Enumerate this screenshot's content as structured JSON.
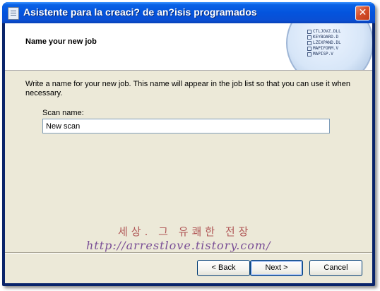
{
  "window": {
    "title": "Asistente para la creaci? de an?isis programados",
    "close_glyph": "✕"
  },
  "header": {
    "title": "Name your new job",
    "graphic_listing": [
      "CTLJOVZ.DLL",
      "KEYBOARD.D",
      "LZEXPAND.DL",
      "MAPIFORM.V",
      "MAPISP.V"
    ]
  },
  "body": {
    "description": "Write a name for your new job. This name will appear in the job list so that you can use it when necessary.",
    "scan_name_label": "Scan name:",
    "scan_name_value": "New scan"
  },
  "watermark": {
    "line1": "세상. 그 유쾌한 전장",
    "line2": "http://arrestlove.tistory.com/"
  },
  "buttons": {
    "back": "< Back",
    "next": "Next >",
    "cancel": "Cancel"
  },
  "colors": {
    "titlebar": "#0454dd",
    "close": "#d5502c",
    "dialog_bg": "#ece9d8",
    "input_border": "#7f9db9"
  }
}
